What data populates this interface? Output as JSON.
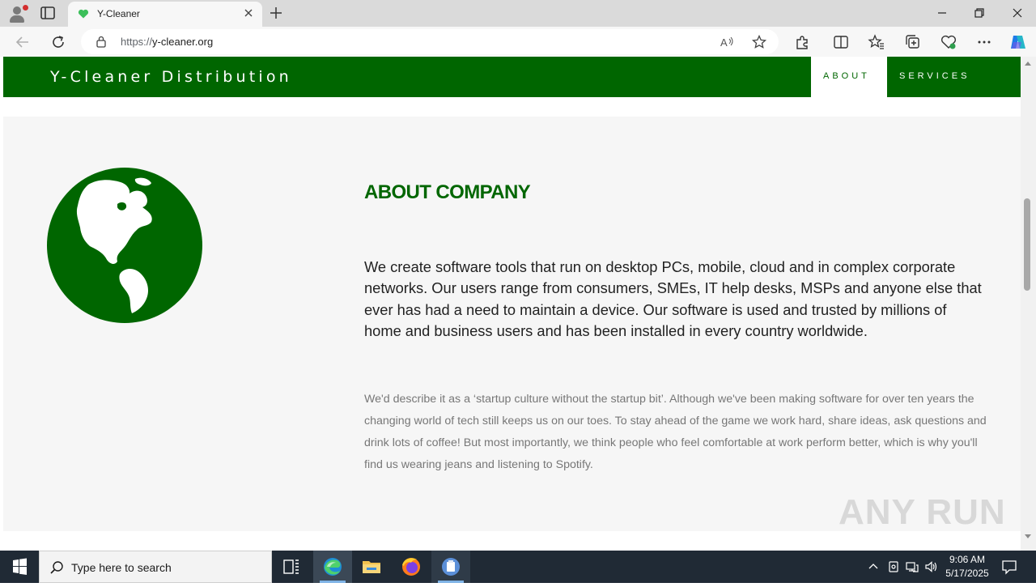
{
  "browser": {
    "tab_title": "Y-Cleaner",
    "url_prefix": "https://",
    "url_domain": "y-cleaner.org"
  },
  "site": {
    "brand": "Y-Cleaner Distribution",
    "nav": {
      "about": "ABOUT",
      "services": "SERVICES"
    },
    "accent_color": "#006600"
  },
  "about": {
    "title": "ABOUT COMPANY",
    "lead": "We create software tools that run on desktop PCs, mobile, cloud and in complex corporate networks. Our users range from consumers, SMEs, IT help desks, MSPs and anyone else that ever has had a need to maintain a device. Our software is used and trusted by millions of home and business users and has been installed in every country worldwide.",
    "body": "We'd describe it as a ‘startup culture without the startup bit’. Although we've been making software for over ten years the changing world of tech still keeps us on our toes. To stay ahead of the game we work hard, share ideas, ask questions and drink lots of coffee! But most importantly, we think people who feel comfortable at work perform better, which is why you'll find us wearing jeans and listening to Spotify."
  },
  "watermark": "ANY RUN",
  "taskbar": {
    "search_placeholder": "Type here to search",
    "time": "9:06 AM",
    "date": "5/17/2025"
  }
}
